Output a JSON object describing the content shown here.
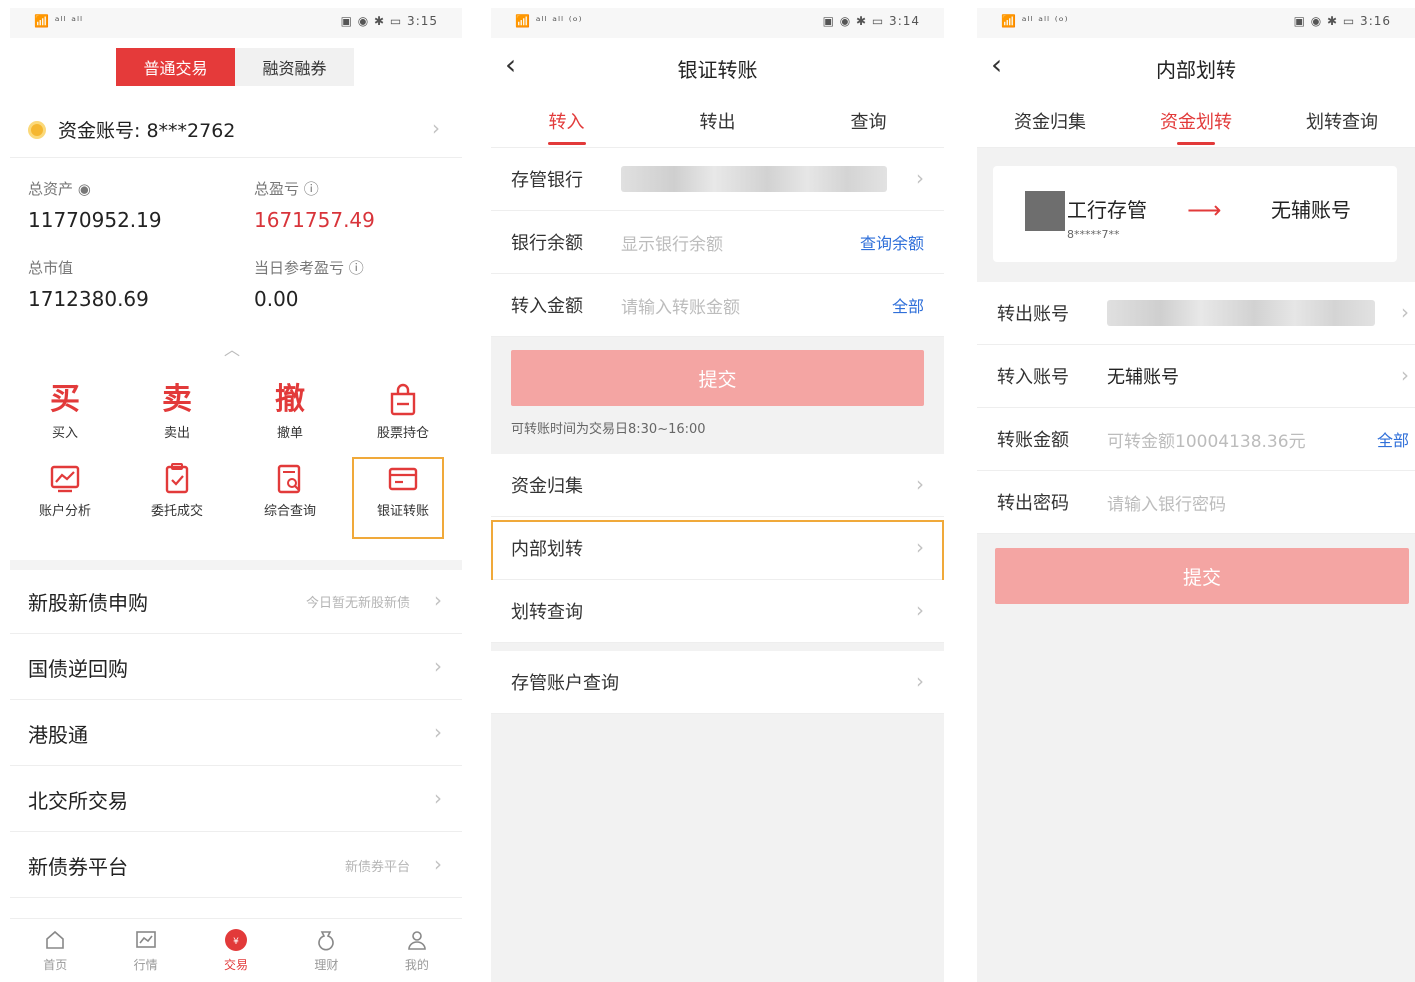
{
  "p1": {
    "status": {
      "left": "📶 ᵃˡˡ ᵃˡˡ",
      "right": "▣ ◉ ✱ ▭ 3:15"
    },
    "segment": {
      "normal": "普通交易",
      "margin": "融资融券"
    },
    "account": {
      "label": "资金账号: 8***2762"
    },
    "stats": {
      "total_assets_label": "总资产",
      "total_assets": "11770952.19",
      "total_pnl_label": "总盈亏",
      "total_pnl": "1671757.49",
      "market_value_label": "总市值",
      "market_value": "1712380.69",
      "today_pnl_label": "当日参考盈亏",
      "today_pnl": "0.00"
    },
    "actions": [
      {
        "glyph": "买",
        "label": "买入"
      },
      {
        "glyph": "卖",
        "label": "卖出"
      },
      {
        "glyph": "撤",
        "label": "撤单"
      },
      {
        "icon": "bag-icon",
        "label": "股票持仓"
      },
      {
        "icon": "chart-icon",
        "label": "账户分析"
      },
      {
        "icon": "clipboard-check-icon",
        "label": "委托成交"
      },
      {
        "icon": "document-search-icon",
        "label": "综合查询"
      },
      {
        "icon": "card-icon",
        "label": "银证转账"
      }
    ],
    "list": [
      {
        "label": "新股新债申购",
        "hint": "今日暂无新股新债"
      },
      {
        "label": "国债逆回购",
        "hint": ""
      },
      {
        "label": "港股通",
        "hint": ""
      },
      {
        "label": "北交所交易",
        "hint": ""
      },
      {
        "label": "新债券平台",
        "hint": "新债券平台"
      }
    ],
    "tabbar": [
      {
        "label": "首页",
        "icon": "home-icon"
      },
      {
        "label": "行情",
        "icon": "chart-icon"
      },
      {
        "label": "交易",
        "icon": "trade-icon"
      },
      {
        "label": "理财",
        "icon": "moneybag-icon"
      },
      {
        "label": "我的",
        "icon": "person-icon"
      }
    ],
    "accent": "#e23a3a",
    "highlight": "#f0a93a"
  },
  "p2": {
    "status": {
      "left": "📶 ᵃˡˡ ᵃˡˡ ⁽ᵒ⁾",
      "right": "▣ ◉ ✱ ▭ 3:14"
    },
    "title": "银证转账",
    "tabs": [
      "转入",
      "转出",
      "查询"
    ],
    "fields": {
      "bank_label": "存管银行",
      "balance_label": "银行余额",
      "balance_placeholder": "显示银行余额",
      "balance_link": "查询余额",
      "amount_label": "转入金额",
      "amount_placeholder": "请输入转账金额",
      "amount_link": "全部"
    },
    "submit": "提交",
    "note": "可转账时间为交易日8:30~16:00",
    "menu": [
      "资金归集",
      "内部划转",
      "划转查询",
      "存管账户查询"
    ]
  },
  "p3": {
    "status": {
      "left": "📶 ᵃˡˡ ᵃˡˡ ⁽ᵒ⁾",
      "right": "▣ ◉ ✱ ▭ 3:16"
    },
    "title": "内部划转",
    "tabs": [
      "资金归集",
      "资金划转",
      "划转查询"
    ],
    "card": {
      "from": "工行存管",
      "from_sub": "8*****7**",
      "to": "无辅账号"
    },
    "fields": {
      "out_label": "转出账号",
      "in_label": "转入账号",
      "in_value": "无辅账号",
      "amount_label": "转账金额",
      "amount_placeholder": "可转金额10004138.36元",
      "amount_link": "全部",
      "pwd_label": "转出密码",
      "pwd_placeholder": "请输入银行密码"
    },
    "submit": "提交"
  }
}
